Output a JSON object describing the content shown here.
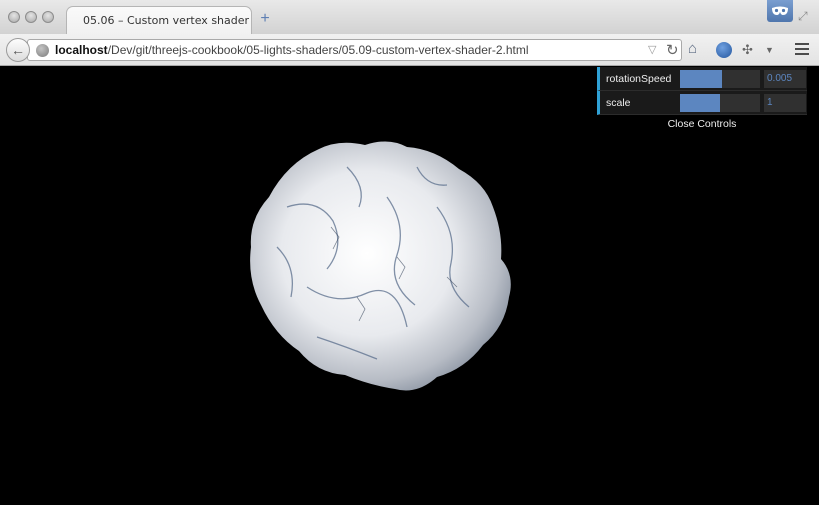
{
  "browser": {
    "tab_title": "05.06 – Custom vertex shader",
    "new_tab_symbol": "+",
    "url_host": "localhost",
    "url_path": "/Dev/git/threejs-cookbook/05-lights-shaders/05.09-custom-vertex-shader-2.html",
    "accent_color": "#5c86c0"
  },
  "gui": {
    "controls": [
      {
        "label": "rotationSpeed",
        "value": "0.005",
        "fill_fraction": 0.52
      },
      {
        "label": "scale",
        "value": "1",
        "fill_fraction": 0.5
      }
    ],
    "close_label": "Close Controls"
  },
  "icons": [
    "back-icon",
    "globe-icon",
    "reload-icon",
    "home-icon",
    "addon-icon",
    "puzzle-icon",
    "menu-icon",
    "mask-icon",
    "fullscreen-icon"
  ]
}
